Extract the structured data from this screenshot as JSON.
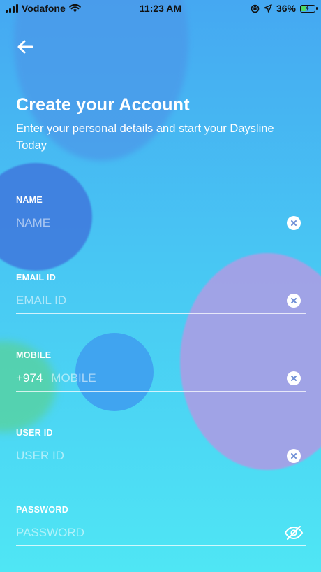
{
  "status_bar": {
    "carrier": "Vodafone",
    "time": "11:23 AM",
    "battery_percent": "36%",
    "battery_level": 0.36,
    "icons": [
      "signal-bars-icon",
      "wifi-icon",
      "orientation-lock-icon",
      "location-arrow-icon",
      "battery-charging-icon"
    ]
  },
  "header": {
    "back_icon": "arrow-left-icon",
    "title": "Create your Account",
    "subtitle": "Enter your personal details and start your Daysline Today"
  },
  "form": {
    "name": {
      "label": "NAME",
      "placeholder": "NAME",
      "value": ""
    },
    "email": {
      "label": "EMAIL ID",
      "placeholder": "EMAIL ID",
      "value": ""
    },
    "mobile": {
      "label": "MOBILE",
      "country_code": "+974",
      "placeholder": "MOBILE",
      "value": ""
    },
    "user_id": {
      "label": "USER ID",
      "placeholder": "USER ID",
      "value": ""
    },
    "password": {
      "label": "PASSWORD",
      "placeholder": "PASSWORD",
      "value": "",
      "toggle_icon": "eye-slash-icon"
    },
    "clear_icon": "clear-x-icon"
  },
  "colors": {
    "gradient_top": "#45a8f2",
    "gradient_bottom": "#4fe6f4",
    "clear_icon_x": "#6f8fd6",
    "text": "#ffffff"
  }
}
